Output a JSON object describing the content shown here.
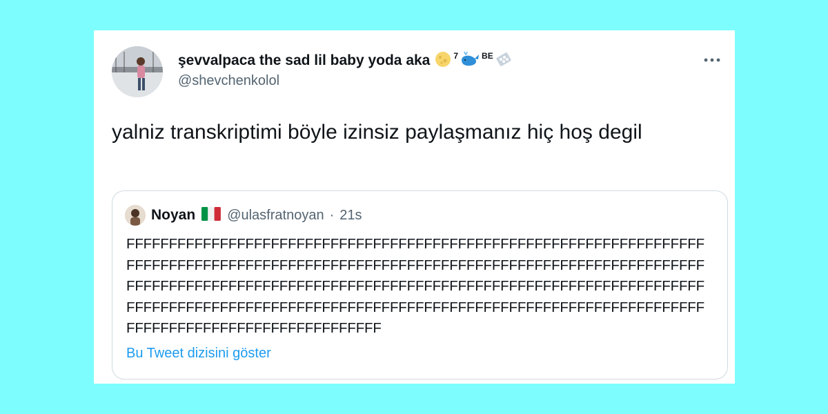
{
  "tweet": {
    "author_name": "şevvalpaca the sad lil baby yoda aka",
    "name_emoji_sup": "7",
    "name_emoji_be": "BE",
    "handle": "@shevchenkolol",
    "text": "yalniz transkriptimi böyle izinsiz paylaşmanız hiç hoş degil",
    "more_icon": "more-dots-icon"
  },
  "quoted": {
    "author_name": "Noyan",
    "flag": "italy-flag",
    "handle": "@ulasfratnoyan",
    "separator": "·",
    "time": "21s",
    "text": "FFFFFFFFFFFFFFFFFFFFFFFFFFFFFFFFFFFFFFFFFFFFFFFFFFFFFFFFFFFFFFFFFFFF\nFFFFFFFFFFFFFFFFFFFFFFFFFFFFFFFFFFFFFFFFFFFFFFFFFFFFFFFFFFFFFFFFFFFF\nFFFFFFFFFFFFFFFFFFFFFFFFFFFFFFFFFFFFFFFFFFFFFFFFFFFFFFFFFFFFFFFFFFFF\nFFFFFFFFFFFFFFFFFFFFFFFFFFFFFFFFFFFFFFFFFFFFFFFFFFFFFFFFFFFFFFFFFFFF\nFFFFFFFFFFFFFFFFFFFFFFFFFFFFFF",
    "show_thread": "Bu Tweet dizisini göster"
  },
  "colors": {
    "background": "#7dfdfd",
    "link": "#1d9bf0",
    "secondary_text": "#536471"
  }
}
